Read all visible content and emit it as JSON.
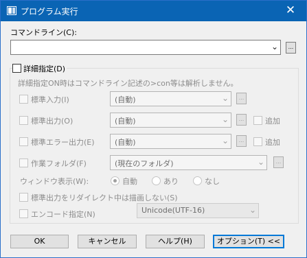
{
  "window": {
    "title": "プログラム実行",
    "close_symbol": "✕"
  },
  "command": {
    "label": "コマンドライン(C):",
    "value": "",
    "browse_label": "..."
  },
  "details": {
    "checkbox_label": "詳細指定(D)",
    "hint": "詳細指定ON時はコマンドライン記述の>con等は解析しません。",
    "stdin": {
      "label": "標準入力(I)",
      "value": "(自動)",
      "browse_label": "..."
    },
    "stdout": {
      "label": "標準出力(O)",
      "value": "(自動)",
      "browse_label": "...",
      "append_label": "追加"
    },
    "stderr": {
      "label": "標準エラー出力(E)",
      "value": "(自動)",
      "browse_label": "...",
      "append_label": "追加"
    },
    "workdir": {
      "label": "作業フォルダ(F)",
      "value": "(現在のフォルダ)",
      "browse_label": "..."
    },
    "window_display": {
      "label": "ウィンドウ表示(W):",
      "options": [
        "自動",
        "あり",
        "なし"
      ],
      "selected": "自動"
    },
    "no_draw_label": "標準出力をリダイレクト中は描画しない(S)",
    "encode": {
      "label": "エンコード指定(N)",
      "value": "Unicode(UTF-16)"
    }
  },
  "buttons": {
    "ok": "OK",
    "cancel": "キャンセル",
    "help": "ヘルプ(H)",
    "options": "オプション(T) <<"
  }
}
